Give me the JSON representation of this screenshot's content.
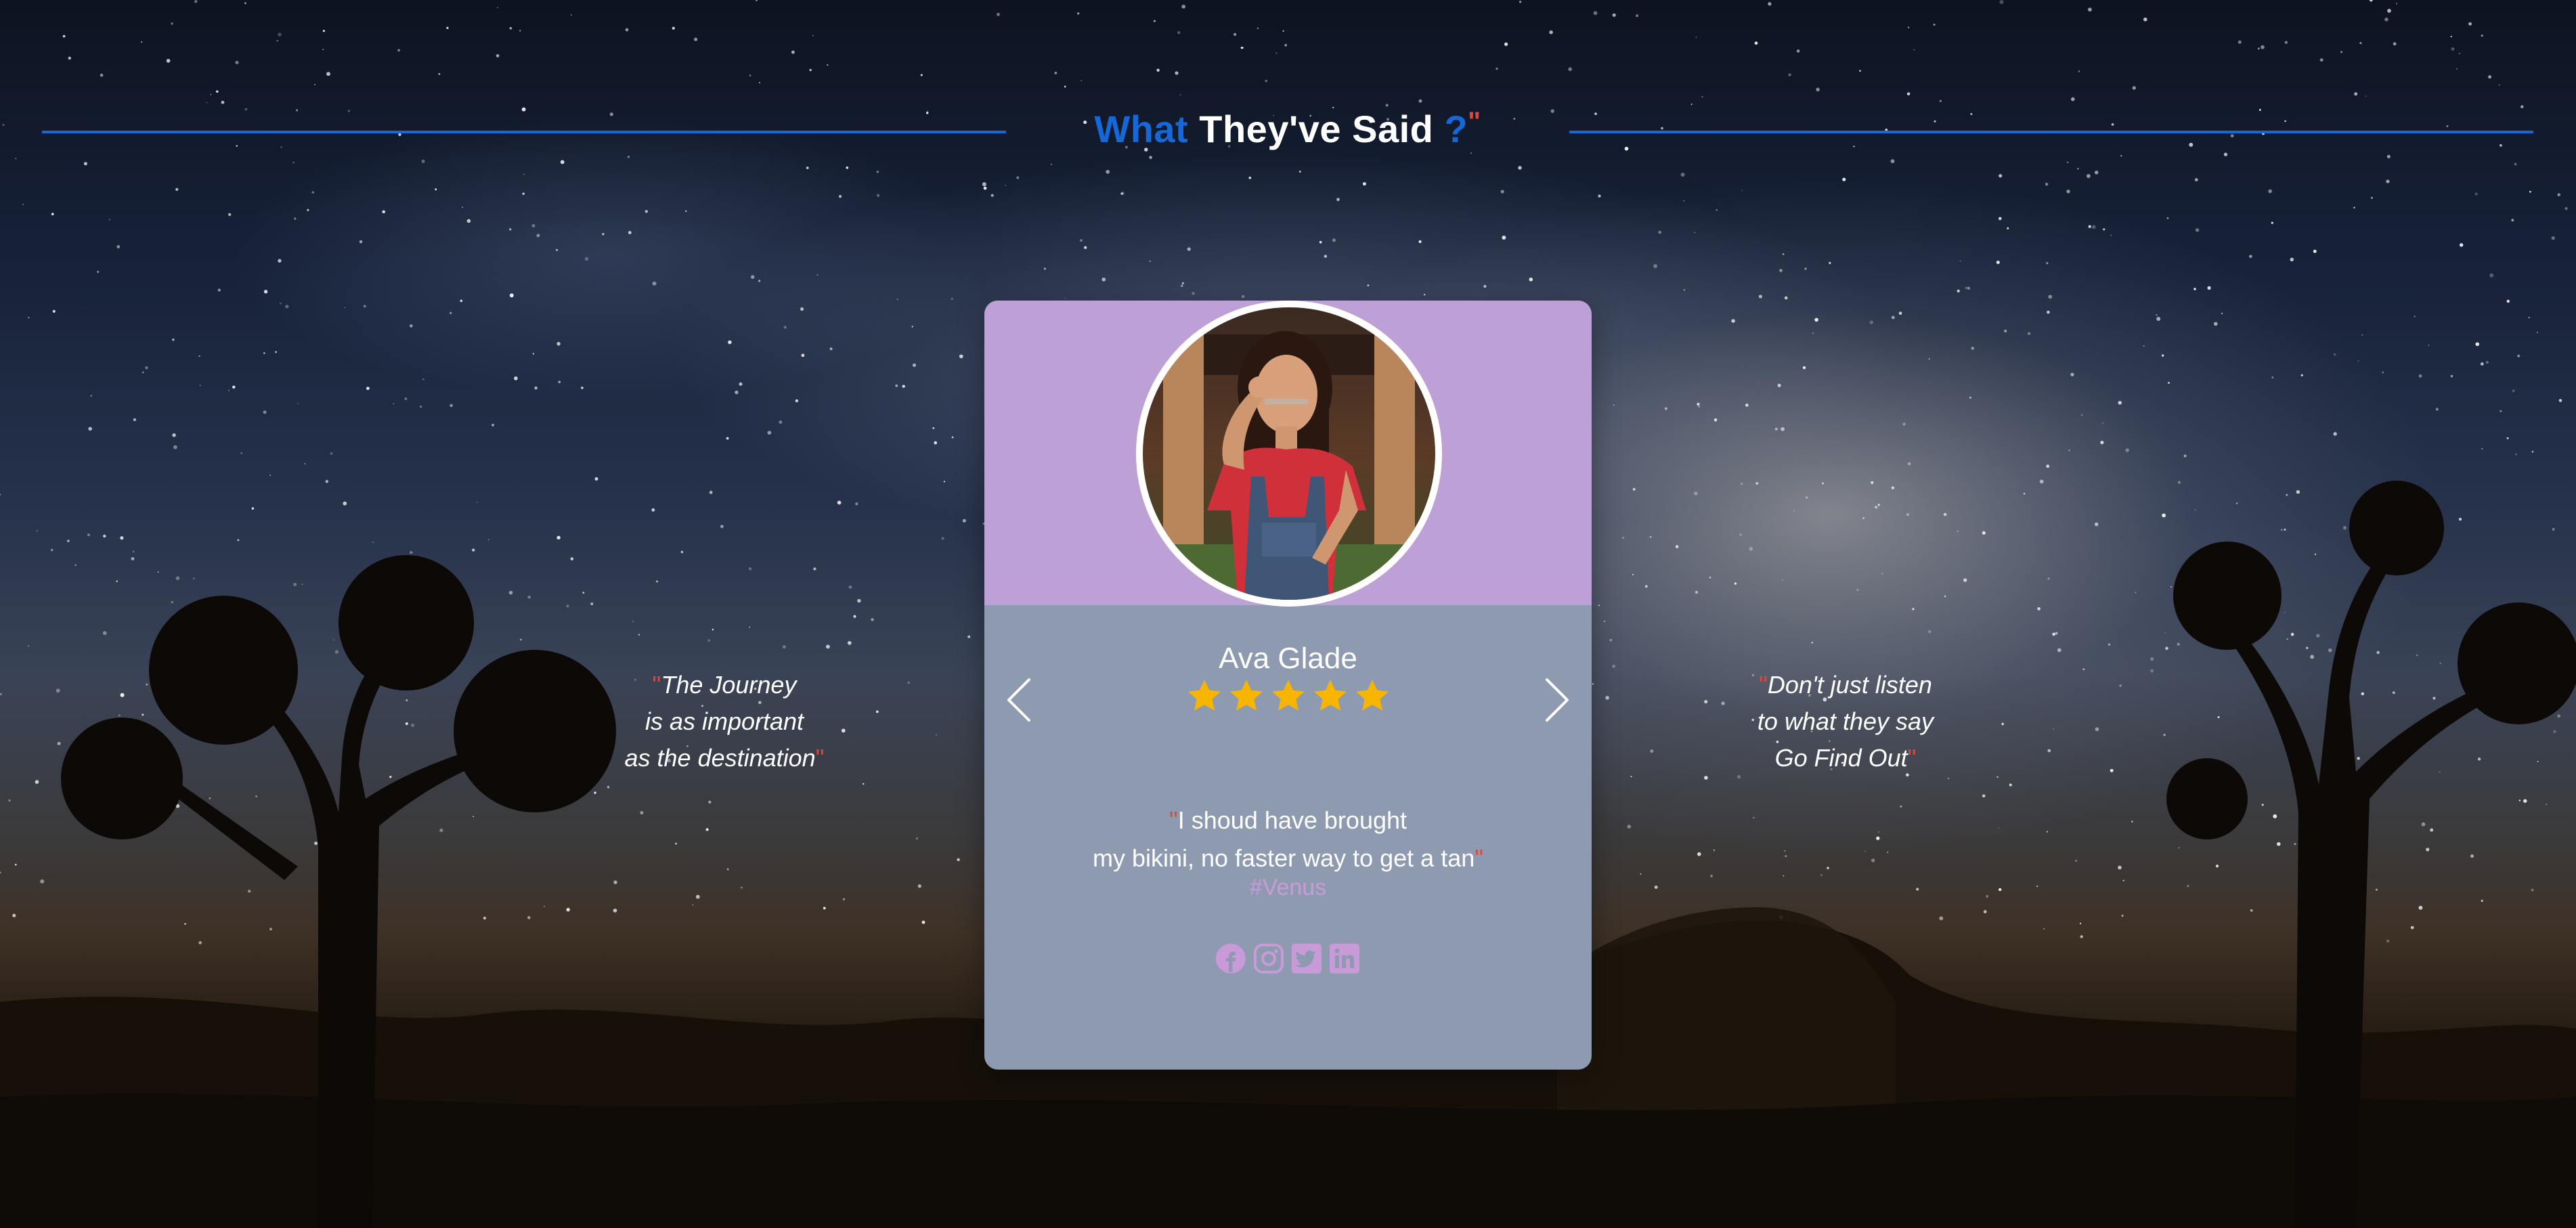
{
  "header": {
    "title_accent": "What",
    "title_main": " They've Said ",
    "title_qmark": "?",
    "title_tick": "\""
  },
  "side_quotes": {
    "left": {
      "open": "\"",
      "lines": [
        "The Journey",
        "is as important",
        "as the destination"
      ],
      "close": "\""
    },
    "right": {
      "open": "\"",
      "lines": [
        "Don't just listen",
        "to what they say",
        "Go Find Out"
      ],
      "close": "\""
    }
  },
  "testimonial": {
    "name": "Ava Glade",
    "rating": 5,
    "rating_max": 5,
    "review_open": "\"",
    "review_lines": [
      "I shoud have brought",
      "my bikini, no faster way to get a tan"
    ],
    "review_close": "\"",
    "hashtag": "#Venus",
    "socials": [
      "facebook-icon",
      "instagram-icon",
      "twitter-icon",
      "linkedin-icon"
    ],
    "avatar": "woman-portrait-photo"
  },
  "navigation": {
    "prev": "chevron-left-icon",
    "next": "chevron-right-icon"
  },
  "colors": {
    "accent_blue": "#1667d8",
    "quote_red": "#e0463c",
    "card_top": "#bda1d6",
    "card_body": "#8e9ab0",
    "hashtag": "#c89bd8",
    "star": "#f7b500",
    "social": "#c89bd8"
  }
}
